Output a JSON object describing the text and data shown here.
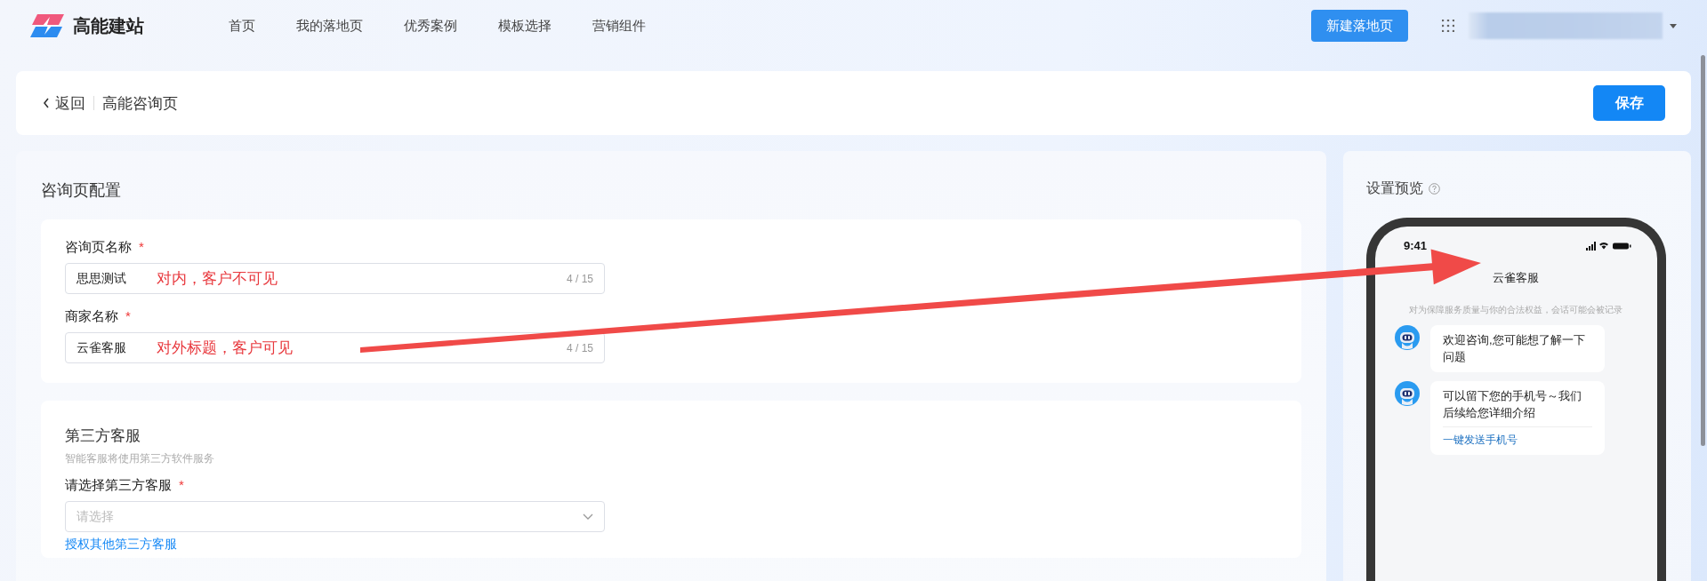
{
  "app": {
    "logo_text": "高能建站"
  },
  "nav": [
    {
      "label": "首页"
    },
    {
      "label": "我的落地页"
    },
    {
      "label": "优秀案例"
    },
    {
      "label": "模板选择"
    },
    {
      "label": "营销组件"
    }
  ],
  "new_button": "新建落地页",
  "header": {
    "back": "返回",
    "title": "高能咨询页",
    "save": "保存"
  },
  "config": {
    "title": "咨询页配置",
    "fields": [
      {
        "label": "咨询页名称",
        "required_mark": "*",
        "value": "思思测试",
        "counter": "4 / 15",
        "annotation": "对内，客户不可见"
      },
      {
        "label": "商家名称",
        "required_mark": "*",
        "value": "云雀客服",
        "counter": "4 / 15",
        "annotation": "对外标题，客户可见"
      }
    ]
  },
  "third_party": {
    "title": "第三方客服",
    "description": "智能客服将使用第三方软件服务",
    "select_label": "请选择第三方客服",
    "required_mark": "*",
    "placeholder": "请选择",
    "link": "授权其他第三方客服"
  },
  "preview": {
    "title": "设置预览",
    "time": "9:41",
    "chat_title": "云雀客服",
    "notice": "对为保障服务质量与你的合法权益，会话可能会被记录",
    "messages": [
      {
        "text": "欢迎咨询,您可能想了解一下问题"
      },
      {
        "text": "可以留下您的手机号～我们后续给您详细介绍",
        "action": "一键发送手机号"
      }
    ]
  }
}
